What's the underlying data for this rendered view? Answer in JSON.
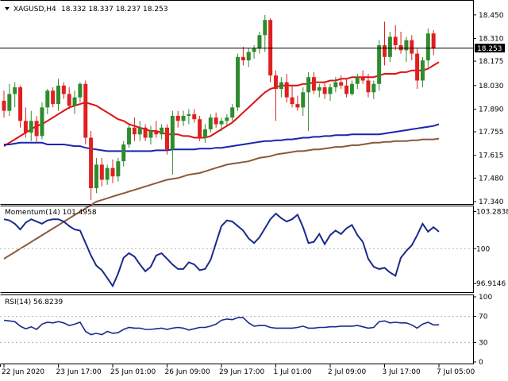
{
  "header": {
    "symbol": "XAGUSD,H4",
    "ohlc": "18.332 18.337 18.237 18.253"
  },
  "colors": {
    "bull": "#2e8b2e",
    "bear": "#e02020",
    "sma_fast": "#dd1111",
    "sma_mid": "#1a24b0",
    "sma_slow": "#8b5a3c",
    "indicator": "#1a2a8c",
    "price_tag_bg": "#000000",
    "grid": "#b0b0b0"
  },
  "chart_data": [
    {
      "type": "candlestick",
      "title": "XAGUSD,H4",
      "ylim": [
        17.34,
        18.52
      ],
      "y_ticks": [
        "18.450",
        "18.310",
        "18.175",
        "18.030",
        "17.890",
        "17.755",
        "17.615",
        "17.480",
        "17.340"
      ],
      "current_price": "18.253",
      "x_tick_labels": [
        "22 Jun 2020",
        "23 Jun 17:00",
        "25 Jun 01:00",
        "26 Jun 09:00",
        "29 Jun 17:00",
        "1 Jul 01:00",
        "2 Jul 09:00",
        "3 Jul 17:00",
        "7 Jul 05:00"
      ],
      "x_tick_index": [
        0,
        10,
        20,
        30,
        40,
        50,
        60,
        70,
        80
      ],
      "candles": [
        [
          17.94,
          18.0,
          17.84,
          17.88
        ],
        [
          17.88,
          18.04,
          17.85,
          17.98
        ],
        [
          17.98,
          18.05,
          17.9,
          18.02
        ],
        [
          18.02,
          18.03,
          17.78,
          17.82
        ],
        [
          17.82,
          17.9,
          17.72,
          17.75
        ],
        [
          17.75,
          17.88,
          17.7,
          17.82
        ],
        [
          17.82,
          17.85,
          17.69,
          17.73
        ],
        [
          17.73,
          17.93,
          17.71,
          17.9
        ],
        [
          17.9,
          18.01,
          17.86,
          18.0
        ],
        [
          18.0,
          18.02,
          17.9,
          17.92
        ],
        [
          17.92,
          18.07,
          17.88,
          18.03
        ],
        [
          18.03,
          18.05,
          17.95,
          17.98
        ],
        [
          17.98,
          18.02,
          17.89,
          17.91
        ],
        [
          17.91,
          18.0,
          17.86,
          17.96
        ],
        [
          17.96,
          18.05,
          17.93,
          18.04
        ],
        [
          18.04,
          18.06,
          17.68,
          17.72
        ],
        [
          17.72,
          17.76,
          17.35,
          17.42
        ],
        [
          17.42,
          17.6,
          17.39,
          17.56
        ],
        [
          17.56,
          17.6,
          17.43,
          17.47
        ],
        [
          17.47,
          17.56,
          17.44,
          17.54
        ],
        [
          17.54,
          17.59,
          17.45,
          17.49
        ],
        [
          17.49,
          17.6,
          17.46,
          17.58
        ],
        [
          17.58,
          17.7,
          17.55,
          17.68
        ],
        [
          17.68,
          17.8,
          17.66,
          17.78
        ],
        [
          17.78,
          17.84,
          17.7,
          17.74
        ],
        [
          17.74,
          17.82,
          17.7,
          17.78
        ],
        [
          17.78,
          17.8,
          17.7,
          17.72
        ],
        [
          17.72,
          17.79,
          17.68,
          17.76
        ],
        [
          17.76,
          17.82,
          17.72,
          17.74
        ],
        [
          17.74,
          17.8,
          17.71,
          17.78
        ],
        [
          17.78,
          17.8,
          17.62,
          17.65
        ],
        [
          17.65,
          17.88,
          17.5,
          17.85
        ],
        [
          17.85,
          17.88,
          17.78,
          17.82
        ],
        [
          17.82,
          17.88,
          17.79,
          17.85
        ],
        [
          17.85,
          17.89,
          17.8,
          17.86
        ],
        [
          17.86,
          17.89,
          17.81,
          17.83
        ],
        [
          17.83,
          17.85,
          17.7,
          17.72
        ],
        [
          17.72,
          17.8,
          17.69,
          17.77
        ],
        [
          17.77,
          17.86,
          17.75,
          17.84
        ],
        [
          17.84,
          17.87,
          17.78,
          17.8
        ],
        [
          17.8,
          17.84,
          17.76,
          17.82
        ],
        [
          17.82,
          17.86,
          17.79,
          17.84
        ],
        [
          17.84,
          17.92,
          17.82,
          17.9
        ],
        [
          17.9,
          18.22,
          17.88,
          18.2
        ],
        [
          18.2,
          18.26,
          18.15,
          18.18
        ],
        [
          18.18,
          18.25,
          18.14,
          18.23
        ],
        [
          18.23,
          18.27,
          18.19,
          18.25
        ],
        [
          18.25,
          18.35,
          18.22,
          18.33
        ],
        [
          18.33,
          18.45,
          18.23,
          18.42
        ],
        [
          18.42,
          18.43,
          18.05,
          18.09
        ],
        [
          18.09,
          18.12,
          17.82,
          18.01
        ],
        [
          18.01,
          18.08,
          17.96,
          18.05
        ],
        [
          18.05,
          18.1,
          17.93,
          17.96
        ],
        [
          17.96,
          18.03,
          17.9,
          17.92
        ],
        [
          17.92,
          17.97,
          17.88,
          17.9
        ],
        [
          17.9,
          18.02,
          17.85,
          17.99
        ],
        [
          17.99,
          18.11,
          17.76,
          18.08
        ],
        [
          18.08,
          18.11,
          17.98,
          18.0
        ],
        [
          18.0,
          18.04,
          17.96,
          18.02
        ],
        [
          18.02,
          18.05,
          17.95,
          17.98
        ],
        [
          17.98,
          18.04,
          17.94,
          18.02
        ],
        [
          18.02,
          18.08,
          17.99,
          18.05
        ],
        [
          18.05,
          18.09,
          18.01,
          18.03
        ],
        [
          18.03,
          18.07,
          17.96,
          17.98
        ],
        [
          17.98,
          18.06,
          17.97,
          18.04
        ],
        [
          18.04,
          18.1,
          18.01,
          18.08
        ],
        [
          18.08,
          18.12,
          18.04,
          18.06
        ],
        [
          18.06,
          18.1,
          17.96,
          17.99
        ],
        [
          17.99,
          18.06,
          17.95,
          18.04
        ],
        [
          18.04,
          18.3,
          18.0,
          18.27
        ],
        [
          18.27,
          18.41,
          18.15,
          18.2
        ],
        [
          18.2,
          18.35,
          18.17,
          18.32
        ],
        [
          18.32,
          18.39,
          18.24,
          18.27
        ],
        [
          18.27,
          18.35,
          18.22,
          18.24
        ],
        [
          18.24,
          18.32,
          18.17,
          18.3
        ],
        [
          18.3,
          18.33,
          18.18,
          18.22
        ],
        [
          18.22,
          18.25,
          18.01,
          18.06
        ],
        [
          18.06,
          18.2,
          18.02,
          18.18
        ],
        [
          18.18,
          18.37,
          18.14,
          18.34
        ],
        [
          18.34,
          18.36,
          18.21,
          18.25
        ]
      ],
      "series": [
        {
          "name": "SMA20",
          "values": [
            17.67,
            17.69,
            17.71,
            17.73,
            17.75,
            17.77,
            17.79,
            17.8,
            17.82,
            17.84,
            17.86,
            17.88,
            17.9,
            17.91,
            17.92,
            17.93,
            17.92,
            17.91,
            17.89,
            17.87,
            17.85,
            17.83,
            17.82,
            17.8,
            17.79,
            17.78,
            17.77,
            17.76,
            17.76,
            17.75,
            17.74,
            17.74,
            17.74,
            17.73,
            17.73,
            17.72,
            17.72,
            17.72,
            17.73,
            17.75,
            17.77,
            17.79,
            17.81,
            17.84,
            17.87,
            17.9,
            17.93,
            17.96,
            17.99,
            18.01,
            18.02,
            18.03,
            18.03,
            18.03,
            18.03,
            18.04,
            18.04,
            18.05,
            18.05,
            18.05,
            18.06,
            18.06,
            18.07,
            18.07,
            18.08,
            18.08,
            18.08,
            18.08,
            18.08,
            18.09,
            18.1,
            18.1,
            18.1,
            18.11,
            18.11,
            18.12,
            18.12,
            18.12,
            18.13,
            18.15,
            18.17
          ]
        },
        {
          "name": "SMA55",
          "values": [
            17.68,
            17.68,
            17.685,
            17.69,
            17.69,
            17.69,
            17.69,
            17.69,
            17.68,
            17.68,
            17.68,
            17.68,
            17.675,
            17.67,
            17.67,
            17.66,
            17.655,
            17.65,
            17.645,
            17.64,
            17.64,
            17.64,
            17.64,
            17.64,
            17.64,
            17.64,
            17.64,
            17.64,
            17.645,
            17.645,
            17.645,
            17.65,
            17.65,
            17.65,
            17.65,
            17.65,
            17.655,
            17.655,
            17.655,
            17.66,
            17.66,
            17.665,
            17.67,
            17.675,
            17.68,
            17.685,
            17.69,
            17.695,
            17.7,
            17.7,
            17.705,
            17.705,
            17.71,
            17.71,
            17.715,
            17.72,
            17.72,
            17.725,
            17.725,
            17.73,
            17.73,
            17.735,
            17.735,
            17.735,
            17.74,
            17.74,
            17.74,
            17.74,
            17.74,
            17.74,
            17.745,
            17.75,
            17.755,
            17.76,
            17.765,
            17.77,
            17.775,
            17.78,
            17.785,
            17.79,
            17.8
          ]
        },
        {
          "name": "SMA200",
          "values": [
            17.0,
            17.02,
            17.04,
            17.06,
            17.08,
            17.1,
            17.12,
            17.14,
            17.16,
            17.18,
            17.2,
            17.22,
            17.24,
            17.26,
            17.28,
            17.3,
            17.32,
            17.34,
            17.35,
            17.36,
            17.37,
            17.38,
            17.39,
            17.4,
            17.41,
            17.42,
            17.43,
            17.44,
            17.45,
            17.46,
            17.47,
            17.475,
            17.48,
            17.49,
            17.5,
            17.505,
            17.51,
            17.52,
            17.53,
            17.54,
            17.55,
            17.56,
            17.565,
            17.57,
            17.575,
            17.58,
            17.59,
            17.6,
            17.605,
            17.61,
            17.62,
            17.625,
            17.63,
            17.635,
            17.64,
            17.64,
            17.645,
            17.65,
            17.65,
            17.655,
            17.66,
            17.665,
            17.665,
            17.67,
            17.675,
            17.675,
            17.68,
            17.685,
            17.69,
            17.69,
            17.695,
            17.695,
            17.7,
            17.7,
            17.7,
            17.705,
            17.705,
            17.71,
            17.71,
            17.71,
            17.715
          ]
        }
      ]
    },
    {
      "type": "line",
      "title": "Momentum(14)",
      "value_label": "101.4958",
      "ylim": [
        96.3,
        103.6
      ],
      "y_ticks": [
        "103.2838",
        "100",
        "96.9146"
      ],
      "series": [
        {
          "name": "Momentum(14)",
          "values": [
            102.6,
            102.5,
            102.2,
            101.7,
            102.3,
            102.6,
            102.4,
            102.2,
            102.5,
            102.6,
            102.6,
            102.4,
            102.0,
            101.7,
            101.6,
            100.5,
            99.4,
            98.5,
            98.1,
            97.4,
            96.7,
            97.8,
            99.2,
            99.6,
            99.3,
            98.6,
            98.0,
            98.4,
            99.4,
            99.6,
            99.1,
            98.6,
            98.2,
            98.2,
            98.8,
            98.6,
            98.1,
            98.2,
            99.0,
            100.5,
            102.0,
            102.5,
            102.4,
            102.0,
            101.6,
            100.9,
            100.5,
            101.0,
            101.8,
            102.6,
            103.1,
            102.7,
            102.4,
            102.6,
            103.0,
            101.9,
            100.5,
            100.6,
            101.3,
            100.4,
            101.2,
            101.6,
            101.3,
            101.8,
            102.1,
            101.2,
            100.6,
            99.1,
            98.4,
            98.2,
            98.3,
            97.9,
            97.6,
            99.2,
            99.8,
            100.3,
            101.2,
            102.2,
            101.5,
            101.9,
            101.5
          ]
        }
      ]
    },
    {
      "type": "line",
      "title": "RSI(14)",
      "value_label": "56.8239",
      "ylim": [
        0,
        100
      ],
      "y_ticks": [
        "100",
        "70",
        "30",
        "0"
      ],
      "series": [
        {
          "name": "RSI(14)",
          "values": [
            64,
            63,
            62,
            55,
            51,
            54,
            50,
            58,
            61,
            60,
            62,
            60,
            56,
            58,
            61,
            47,
            42,
            44,
            42,
            47,
            44,
            45,
            50,
            53,
            52,
            52,
            50,
            50,
            51,
            52,
            50,
            52,
            53,
            52,
            49,
            51,
            53,
            53,
            55,
            58,
            64,
            66,
            65,
            68,
            68,
            60,
            55,
            56,
            56,
            53,
            52,
            52,
            52,
            52,
            53,
            55,
            52,
            52,
            53,
            53,
            54,
            54,
            55,
            55,
            55,
            56,
            54,
            52,
            53,
            62,
            63,
            60,
            61,
            60,
            60,
            57,
            52,
            58,
            61,
            57,
            57
          ]
        }
      ]
    }
  ]
}
